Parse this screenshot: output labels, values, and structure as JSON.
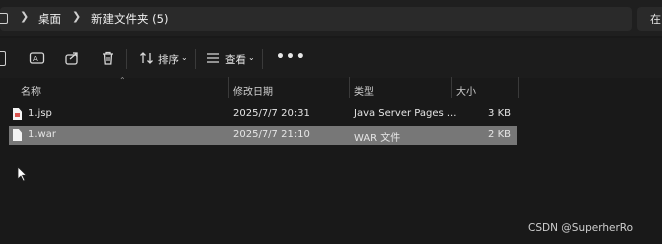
{
  "breadcrumb": {
    "items": [
      "桌面",
      "新建文件夹 (5)"
    ],
    "right_search_text": "在"
  },
  "toolbar": {
    "sort_label": "排序",
    "view_label": "查看"
  },
  "columns": {
    "name": "名称",
    "modified": "修改日期",
    "type": "类型",
    "size": "大小"
  },
  "files": [
    {
      "name": "1.jsp",
      "modified": "2025/7/7 20:31",
      "type": "Java Server Pages ...",
      "size": "3 KB",
      "selected": false
    },
    {
      "name": "1.war",
      "modified": "2025/7/7 21:10",
      "type": "WAR 文件",
      "size": "2 KB",
      "selected": true
    }
  ],
  "watermark": "CSDN @SuperherRo",
  "colors": {
    "background": "#191919",
    "selected_row": "#777777",
    "jsp_icon_accent": "#d9534f"
  }
}
